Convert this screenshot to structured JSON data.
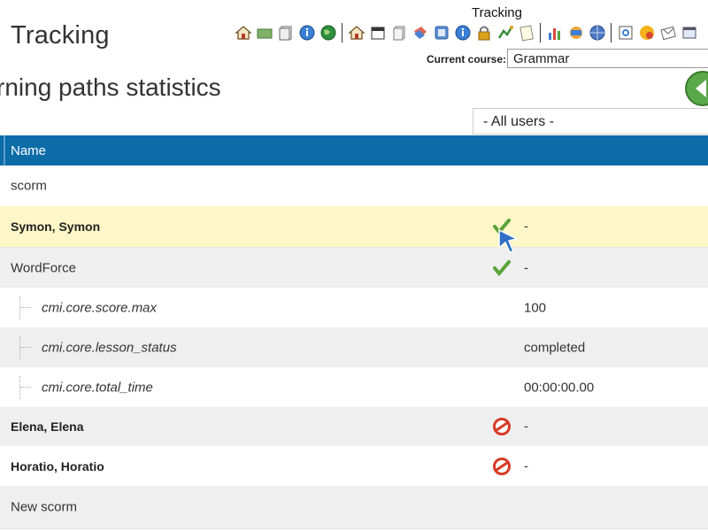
{
  "header": {
    "app_title": "Tracking",
    "page_title": "rning paths statistics",
    "tooltip": "Tracking",
    "course_label": "Current course:",
    "course_value": "Grammar",
    "user_filter": "- All users -"
  },
  "toolbar_icons": [
    "home-icon",
    "folder-icon",
    "pages-icon",
    "info-icon",
    "globe-icon",
    "home-icon",
    "calendar-icon",
    "documents-icon",
    "tags-icon",
    "forum-icon",
    "info-icon",
    "lock-icon",
    "path-icon",
    "notes-icon",
    "chart-icon",
    "news-icon",
    "globe-icon",
    "preview-icon",
    "colors-icon",
    "mail-icon",
    "window-icon"
  ],
  "colors": {
    "header_bar": "#0b6ca8",
    "highlight_row": "#fdf7c8",
    "alt_row": "#efefef"
  },
  "table": {
    "column_name": "Name",
    "rows": [
      {
        "name": "scorm",
        "style": "plain",
        "status": "",
        "value": ""
      },
      {
        "name": "Symon, Symon",
        "style": "bold",
        "status": "passed",
        "value": "-"
      },
      {
        "name": "WordForce",
        "style": "plain",
        "status": "passed",
        "value": "-"
      },
      {
        "name": "cmi.core.score.max",
        "style": "child",
        "status": "",
        "value": "100"
      },
      {
        "name": "cmi.core.lesson_status",
        "style": "child",
        "status": "",
        "value": "completed"
      },
      {
        "name": "cmi.core.total_time",
        "style": "child",
        "status": "",
        "value": "00:00:00.00"
      },
      {
        "name": "Elena, Elena",
        "style": "bold",
        "status": "failed",
        "value": "-"
      },
      {
        "name": "Horatio, Horatio",
        "style": "bold",
        "status": "failed",
        "value": "-"
      },
      {
        "name": "New scorm",
        "style": "plain",
        "status": "",
        "value": ""
      }
    ]
  }
}
